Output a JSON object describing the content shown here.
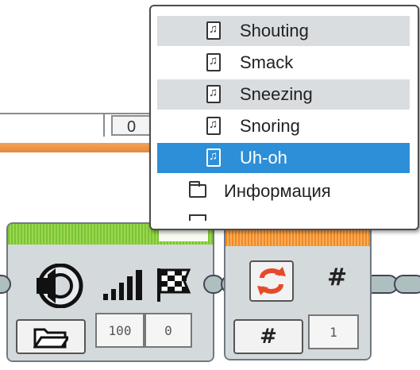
{
  "background": {
    "field_value": "0"
  },
  "menu": {
    "items": [
      {
        "label": "Shouting",
        "icon": "sound-file-icon",
        "state": "alt"
      },
      {
        "label": "Smack",
        "icon": "sound-file-icon",
        "state": "normal"
      },
      {
        "label": "Sneezing",
        "icon": "sound-file-icon",
        "state": "alt"
      },
      {
        "label": "Snoring",
        "icon": "sound-file-icon",
        "state": "normal"
      },
      {
        "label": "Uh-oh",
        "icon": "sound-file-icon",
        "state": "selected"
      },
      {
        "label": "Информация",
        "icon": "folder-icon",
        "state": "normal"
      }
    ],
    "selected_color": "#2d8fd8",
    "alt_row_color": "#d9dde0"
  },
  "sound_block": {
    "header_color": "#7cc433",
    "icons": [
      "speaker-icon",
      "volume-bars-icon",
      "checkered-flag-icon",
      "folder-icon"
    ],
    "volume": "100",
    "play_type": "0"
  },
  "loop_block": {
    "header_color": "#f08a24",
    "icons": [
      "loop-arrows-icon",
      "hash-icon"
    ],
    "hash_label": "#",
    "count_mode_label": "#",
    "count": "1"
  }
}
